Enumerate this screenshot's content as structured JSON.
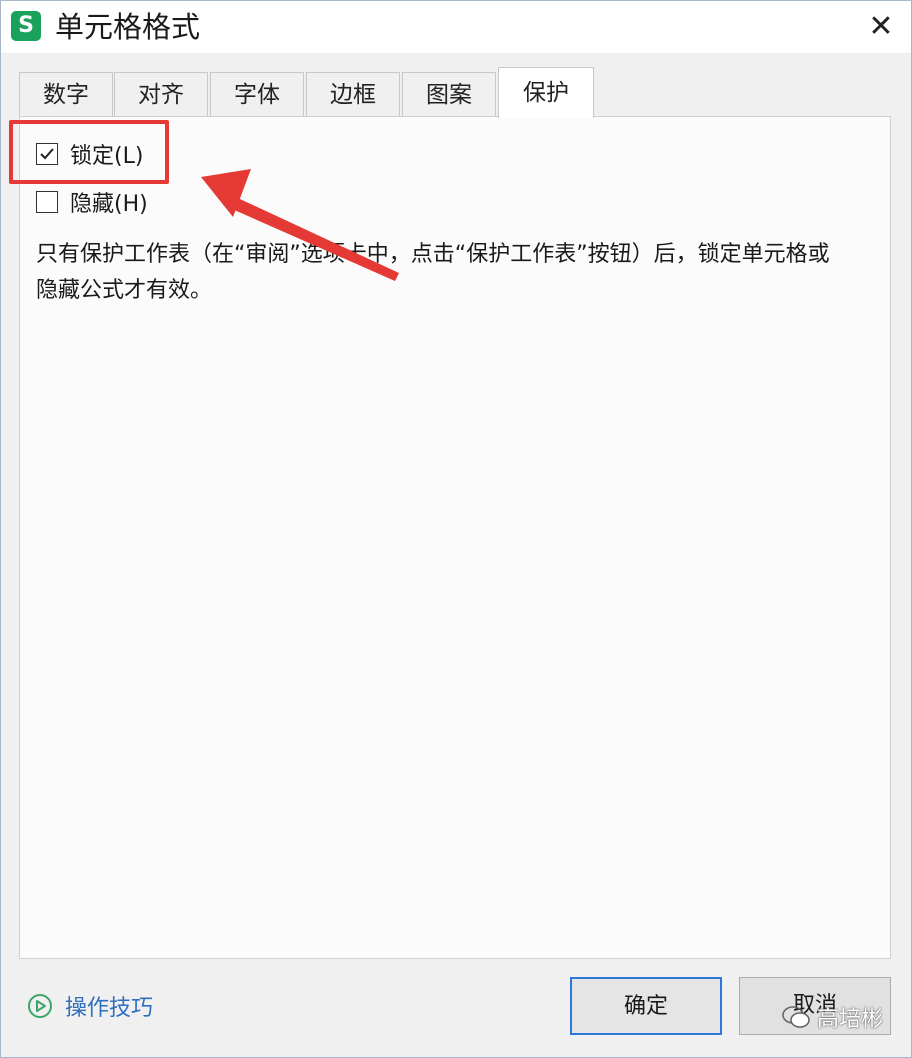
{
  "window": {
    "title": "单元格格式",
    "app_icon_letter": "S",
    "close_glyph": "✕"
  },
  "tabs": [
    {
      "label": "数字",
      "active": false
    },
    {
      "label": "对齐",
      "active": false
    },
    {
      "label": "字体",
      "active": false
    },
    {
      "label": "边框",
      "active": false
    },
    {
      "label": "图案",
      "active": false
    },
    {
      "label": "保护",
      "active": true
    }
  ],
  "protection": {
    "lock": {
      "label": "锁定(L)",
      "checked": true
    },
    "hide": {
      "label": "隐藏(H)",
      "checked": false
    },
    "description": "只有保护工作表（在“审阅”选项卡中，点击“保护工作表”按钮）后，锁定单元格或隐藏公式才有效。"
  },
  "footer": {
    "tips_label": "操作技巧",
    "ok_label": "确定",
    "cancel_label": "取消"
  },
  "watermark": {
    "text": "高培彬"
  },
  "colors": {
    "highlight": "#e53935",
    "link": "#2f6fc0",
    "app_icon": "#1aa15c",
    "primary_border": "#2f78d8"
  },
  "icons": {
    "app": "wps-spreadsheet-icon",
    "close": "close-icon",
    "checkmark": "checkmark-icon",
    "tips": "play-circle-icon",
    "watermark": "wechat-icon"
  }
}
